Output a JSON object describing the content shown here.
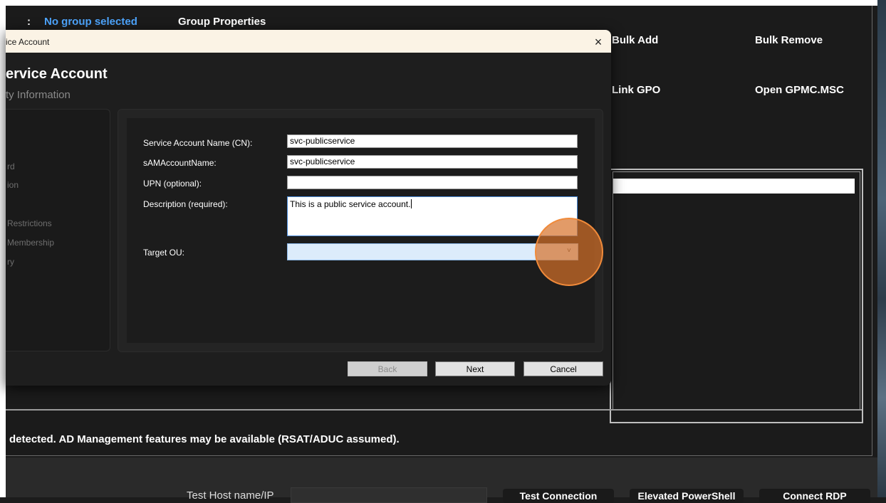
{
  "header": {
    "no_group": "No group selected",
    "group_properties": "Group Properties",
    "colon": ":"
  },
  "actions": {
    "bulk_add": "Bulk Add",
    "bulk_remove": "Bulk Remove",
    "link_gpo": "Link GPO",
    "open_gpmc": "Open GPMC.MSC"
  },
  "status": "detected. AD Management features may be available (RSAT/ADUC assumed).",
  "bottom": {
    "host_label": "Test Host name/IP",
    "test_connection": "Test Connection",
    "elevated_ps": "Elevated PowerShell",
    "connect_rdp": "Connect RDP"
  },
  "dialog": {
    "window_title": "ice Account",
    "heading": "ervice Account",
    "subheading": "ty Information",
    "steps": [
      "rd",
      "ion",
      "Restrictions",
      "Membership",
      "ry"
    ],
    "labels": {
      "cn": "Service Account Name (CN):",
      "sam": "sAMAccountName:",
      "upn": "UPN (optional):",
      "description": "Description (required):",
      "target_ou": "Target OU:"
    },
    "values": {
      "cn": "svc-publicservice",
      "sam": "svc-publicservice",
      "upn": "",
      "description": "This is a public service account.",
      "target_ou": ""
    },
    "buttons": {
      "back": "Back",
      "next": "Next",
      "cancel": "Cancel"
    },
    "close_glyph": "×",
    "chevron_glyph": "˅"
  }
}
